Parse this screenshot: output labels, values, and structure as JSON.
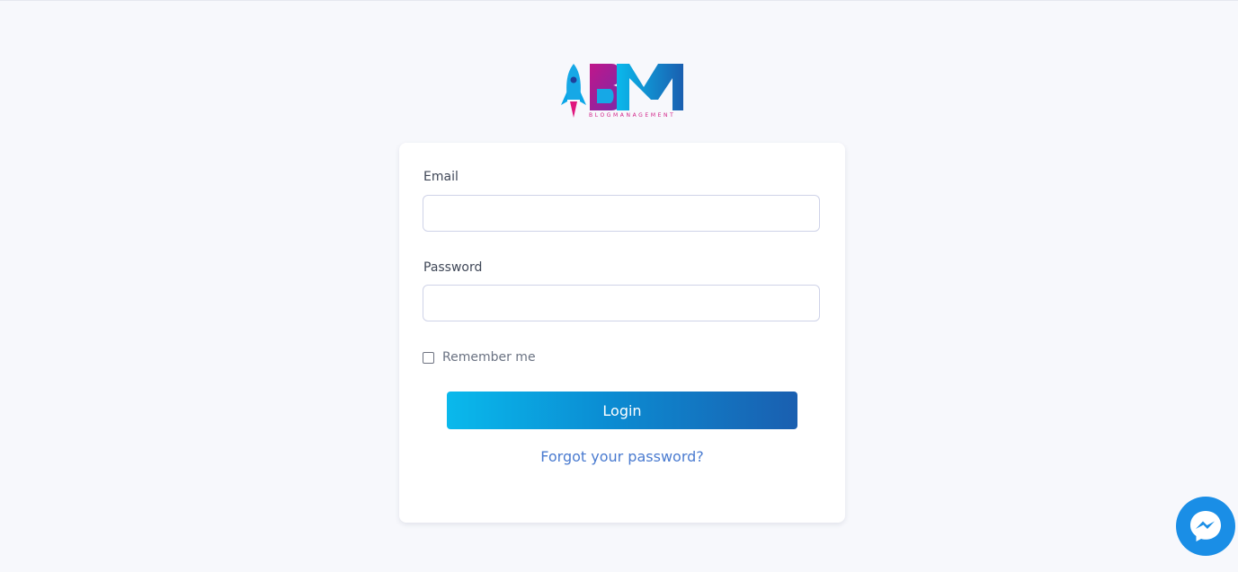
{
  "brand": {
    "logo_letters": "BM",
    "logo_subtitle": "BLOGMANAGEMENT",
    "colors": {
      "blue": "#0ab9ec",
      "magenta": "#b0168a",
      "dark_blue": "#1a5fb0"
    }
  },
  "form": {
    "email_label": "Email",
    "email_value": "",
    "password_label": "Password",
    "password_value": "",
    "remember_label": "Remember me",
    "remember_checked": false,
    "login_label": "Login",
    "forgot_label": "Forgot your password?"
  },
  "widgets": {
    "chat_icon": "messenger-icon"
  }
}
